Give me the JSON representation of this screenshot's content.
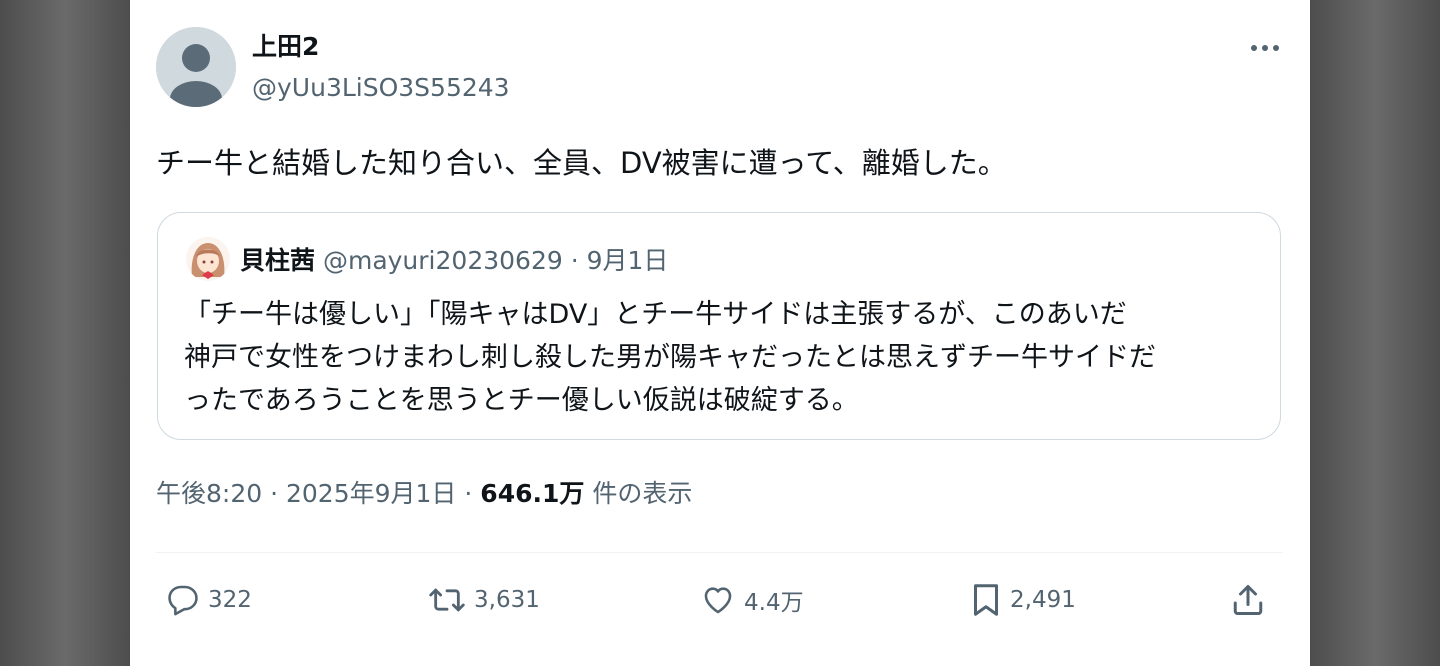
{
  "author": {
    "display_name": "上田2",
    "handle": "@yUu3LiSO3S55243"
  },
  "tweet": {
    "text": "チー牛と結婚した知り合い、全員、DV被害に遭って、離婚した。"
  },
  "quoted_tweet": {
    "display_name": "貝柱茜",
    "handle": "@mayuri20230629",
    "date": "9月1日",
    "body_lines": [
      "「チー牛は優しい」「陽キャはDV」とチー牛サイドは主張するが、このあいだ",
      "神戸で女性をつけまわし刺し殺した男が陽キャだったとは思えずチー牛サイドだ",
      "ったであろうことを思うとチー優しい仮説は破綻する。"
    ]
  },
  "meta": {
    "time": "午後8:20",
    "date": "2025年9月1日",
    "views_count": "646.1万",
    "views_label": "件の表示"
  },
  "actions": {
    "replies": "322",
    "retweets": "3,631",
    "likes": "4.4万",
    "bookmarks": "2,491"
  },
  "icons": {
    "more": "more-horizontal-icon",
    "reply": "reply-bubble-icon",
    "retweet": "retweet-icon",
    "like": "heart-icon",
    "bookmark": "bookmark-icon",
    "share": "share-upload-icon"
  },
  "colors": {
    "text_primary": "#0f1419",
    "text_secondary": "#536471",
    "border": "#cfd9de",
    "avatar_bg": "#cfd9de"
  }
}
